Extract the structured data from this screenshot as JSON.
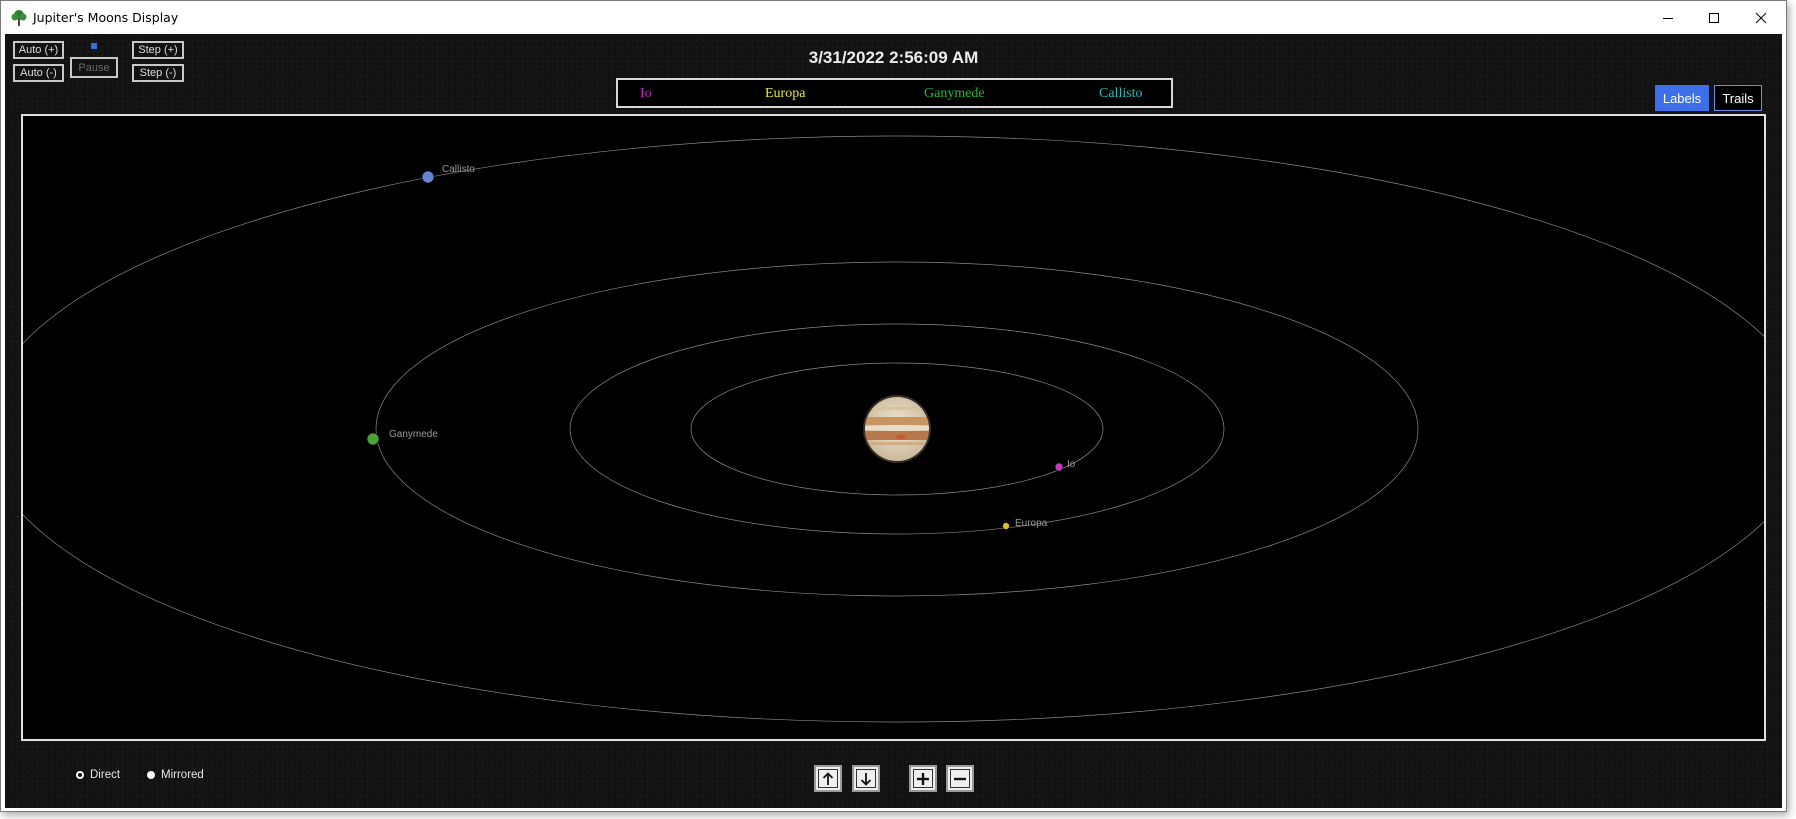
{
  "window": {
    "title": "Jupiter's Moons Display",
    "app_icon": "tree-icon"
  },
  "controls": {
    "auto_plus": "Auto  (+)",
    "auto_minus": "Auto  (-)",
    "pause": "Pause",
    "step_plus": "Step  (+)",
    "step_minus": "Step  (-)"
  },
  "datetime": "3/31/2022 2:56:09 AM",
  "legend": [
    {
      "name": "Io",
      "color": "#cc22cc"
    },
    {
      "name": "Europa",
      "color": "#e8e830"
    },
    {
      "name": "Ganymede",
      "color": "#22bb33"
    },
    {
      "name": "Callisto",
      "color": "#22c0c0"
    }
  ],
  "toggles": {
    "labels": "Labels",
    "trails": "Trails"
  },
  "moons": [
    {
      "name": "Io",
      "label": "Io",
      "color": "#c23fc2"
    },
    {
      "name": "Europa",
      "label": "Europa",
      "color": "#d8c02a"
    },
    {
      "name": "Ganymede",
      "label": "Ganymede",
      "color": "#49a336"
    },
    {
      "name": "Callisto",
      "label": "Callisto",
      "color": "#5f86cf"
    }
  ],
  "view_mode": {
    "direct": "Direct",
    "mirrored": "Mirrored",
    "selected": "mirrored"
  },
  "nav_icons": [
    "arrow-up-icon",
    "arrow-down-icon",
    "plus-icon",
    "minus-icon"
  ]
}
